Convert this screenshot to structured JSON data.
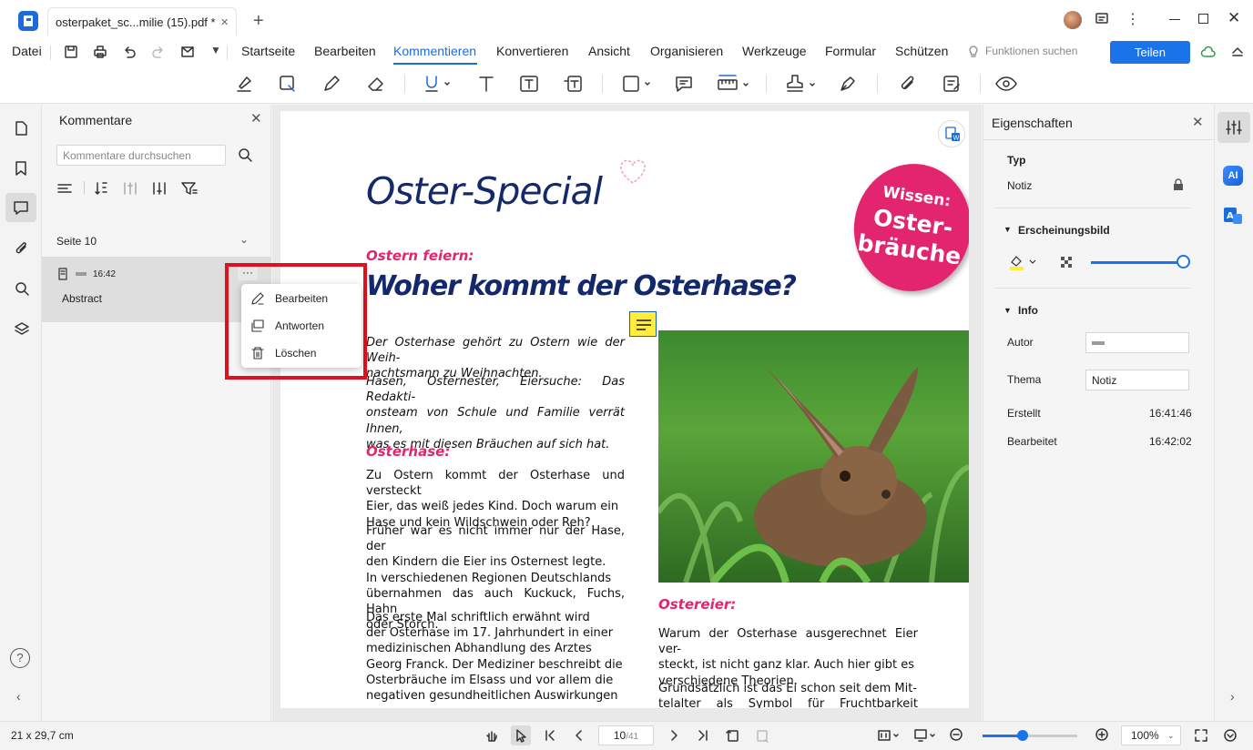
{
  "titlebar": {
    "tab_title": "osterpaket_sc...milie (15).pdf *",
    "tab_close": "×",
    "new_tab": "+"
  },
  "menubar": {
    "file": "Datei",
    "items": [
      "Startseite",
      "Bearbeiten",
      "Kommentieren",
      "Konvertieren",
      "Ansicht",
      "Organisieren",
      "Werkzeuge",
      "Formular",
      "Schützen"
    ],
    "active": "Kommentieren",
    "search_features": "Funktionen suchen",
    "share": "Teilen"
  },
  "comments_panel": {
    "title": "Kommentare",
    "search_placeholder": "Kommentare durchsuchen",
    "page_group": "Seite 10",
    "comment": {
      "time": "16:42",
      "text": "Abstract",
      "more": "···"
    }
  },
  "context_menu": {
    "edit": "Bearbeiten",
    "reply": "Antworten",
    "delete": "Löschen"
  },
  "document": {
    "title": "Oster-Special",
    "badge_top": "Wissen:",
    "badge_line1": "Oster-",
    "badge_line2": "bräuche",
    "kicker": "Ostern feiern:",
    "headline": "Woher kommt der Osterhase?",
    "intro1": "Der Osterhase gehört zu Ostern wie der Weih-\nnachtsmann zu Weihnachten.",
    "intro2": "Hasen, Osternester, Eiersuche: Das Redakti-\nonsteam von Schule und Familie verrät Ihnen,\nwas es mit diesen Bräuchen auf sich hat.",
    "section1_heading": "Osterhase:",
    "section1_p1": "Zu Ostern kommt der Osterhase und versteckt\nEier, das weiß jedes Kind. Doch warum ein\nHase und kein Wildschwein oder Reh?",
    "section1_p2": "Früher war es nicht immer nur der Hase, der\nden Kindern die Eier ins Osternest legte.\nIn verschiedenen Regionen Deutschlands\nübernahmen das auch Kuckuck, Fuchs, Hahn\noder Storch.",
    "section1_p3": "Das erste Mal schriftlich erwähnt wird\nder Osterhase im 17. Jahrhundert in einer\nmedizinischen Abhandlung des Arztes\nGeorg Franck. Der Mediziner beschreibt die\nOsterbräuche im Elsass und vor allem die\nnegativen gesundheitlichen Auswirkungen",
    "section2_heading": "Ostereier:",
    "section2_p1": "Warum der Osterhase ausgerechnet Eier ver-\nsteckt, ist nicht ganz klar. Auch hier gibt es\nverschiedene Theorien.",
    "section2_p2": "Grundsätzlich ist das Ei schon seit dem Mit-\ntelalter als Symbol für Fruchtbarkeit bekannt"
  },
  "properties": {
    "title": "Eigenschaften",
    "type_label": "Typ",
    "type_value": "Notiz",
    "appearance_label": "Erscheinungsbild",
    "opacity": 1.0,
    "info_label": "Info",
    "author_label": "Autor",
    "author_value": "",
    "subject_label": "Thema",
    "subject_value": "Notiz",
    "created_label": "Erstellt",
    "created_value": "16:41:46",
    "modified_label": "Bearbeitet",
    "modified_value": "16:42:02"
  },
  "rightrail": {
    "ai": "AI"
  },
  "statusbar": {
    "page_size": "21 x 29,7 cm",
    "current_page": "10",
    "total_pages": "/41",
    "zoom": "100%",
    "zoom_level": 0.42
  },
  "colors": {
    "accent": "#1a73e8",
    "pink": "#e3246f",
    "navy": "#14296b",
    "highlight": "#e0111c"
  }
}
